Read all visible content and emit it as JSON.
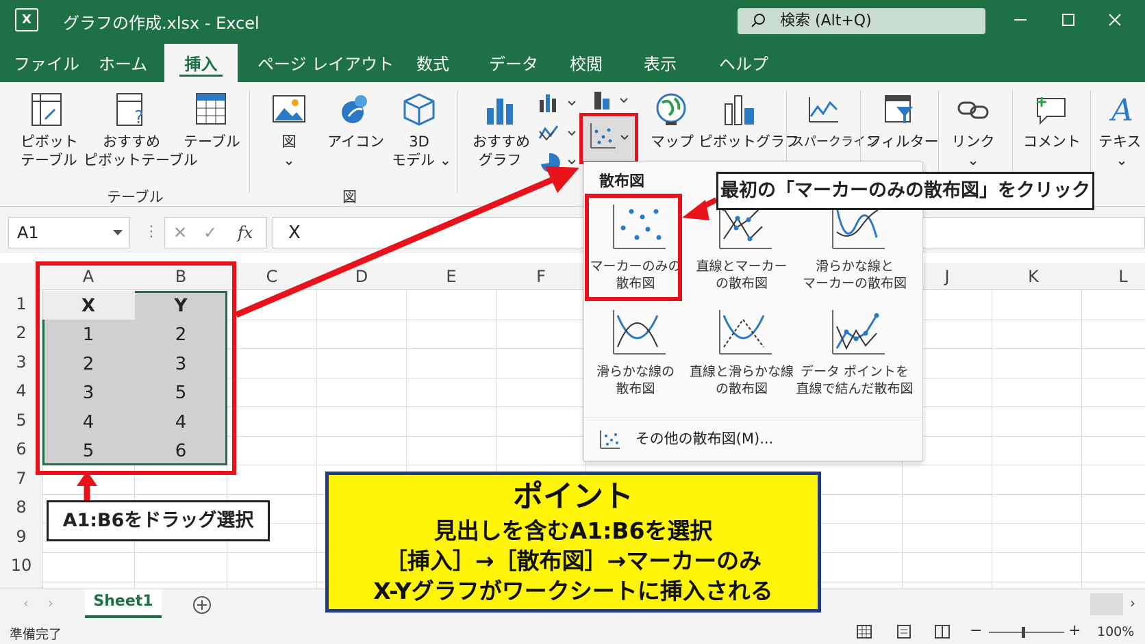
{
  "titlebar": {
    "app_icon": "X",
    "doc_title": "グラフの作成.xlsx  -  Excel",
    "search_placeholder": "検索 (Alt+Q)"
  },
  "menu": {
    "file": "ファイル",
    "home": "ホーム",
    "insert": "挿入",
    "page_layout": "ページ レイアウト",
    "formulas": "数式",
    "data": "データ",
    "review": "校閲",
    "view": "表示",
    "help": "ヘルプ"
  },
  "ribbon": {
    "pivot_table": [
      "ピボット",
      "テーブル"
    ],
    "rec_pivot": [
      "おすすめ",
      "ピボットテーブル"
    ],
    "table": "テーブル",
    "group_tables": "テーブル",
    "pictures": "図",
    "icons": "アイコン",
    "models3d": [
      "3D",
      "モデル ⌄"
    ],
    "group_illustrations": "図",
    "rec_charts": [
      "おすすめ",
      "グラフ"
    ],
    "maps": "マップ",
    "pivot_chart": "ピボットグラフ",
    "sparklines": "スパークライン",
    "filters": "フィルター",
    "link": "リンク",
    "comment": "コメント",
    "text": "テキスト"
  },
  "formula_bar": {
    "name_box": "A1",
    "fx": "fx",
    "value": "X"
  },
  "sheet": {
    "columns": [
      "A",
      "B",
      "C",
      "D",
      "E",
      "F",
      "J",
      "K",
      "L"
    ],
    "rows": [
      "1",
      "2",
      "3",
      "4",
      "5",
      "6",
      "7",
      "8",
      "9",
      "10"
    ],
    "cells": {
      "A": [
        "X",
        "1",
        "2",
        "3",
        "4",
        "5"
      ],
      "B": [
        "Y",
        "2",
        "3",
        "5",
        "4",
        "6"
      ]
    },
    "tab": "Sheet1"
  },
  "dropdown": {
    "title": "散布図",
    "options": [
      [
        "マーカーのみの",
        "散布図"
      ],
      [
        "直線とマーカー",
        "の散布図"
      ],
      [
        "滑らかな線と",
        "マーカーの散布図"
      ],
      [
        "滑らかな線の",
        "散布図"
      ],
      [
        "直線と滑らかな線",
        "の散布図"
      ],
      [
        "データ ポイントを",
        "直線で結んだ散布図"
      ]
    ],
    "more": "その他の散布図(M)..."
  },
  "callouts": {
    "click": "最初の「マーカーのみの散布図」をクリック",
    "drag": "A1:B6をドラッグ選択"
  },
  "point": {
    "title": "ポイント",
    "lines": [
      "見出しを含むA1:B6を選択",
      "［挿入］→［散布図］→マーカーのみ",
      "X-Yグラフがワークシートに挿入される"
    ]
  },
  "status": {
    "ready": "準備完了",
    "zoom": "100%"
  },
  "colors": {
    "excel_green": "#1e7145",
    "highlight_red": "#e8121b",
    "point_yellow": "#fdf40a",
    "point_border": "#1f3a8a"
  }
}
